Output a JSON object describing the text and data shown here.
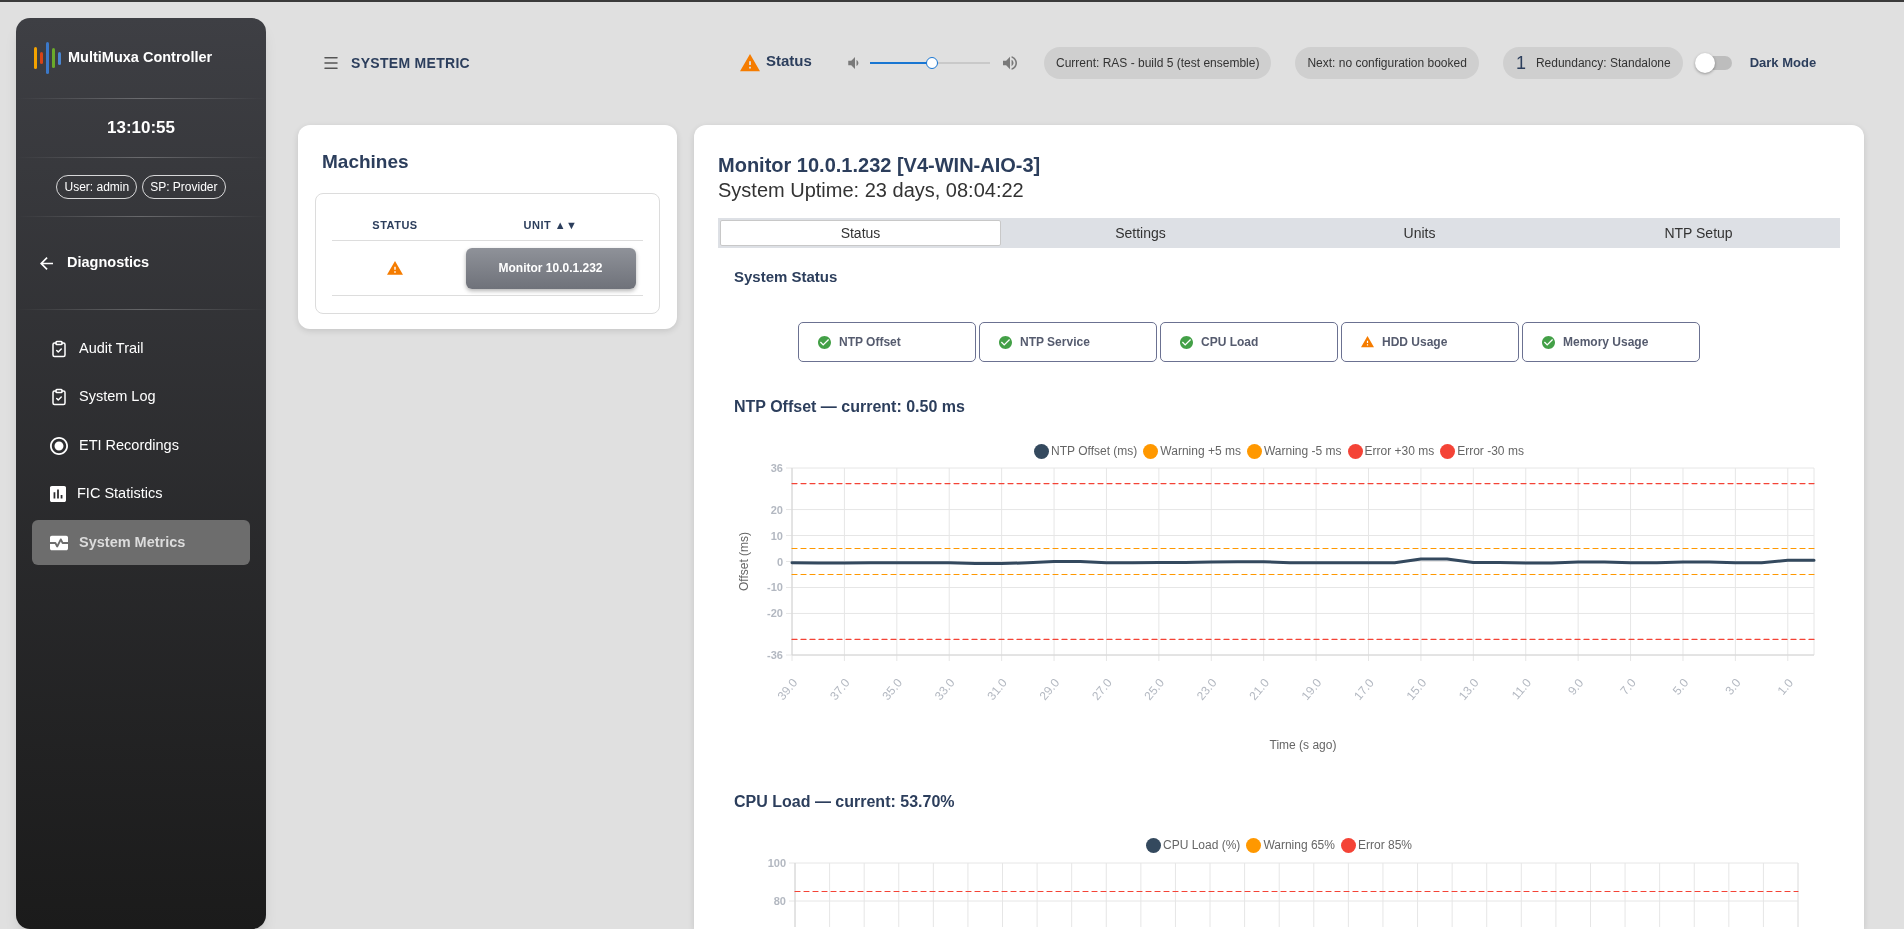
{
  "sidebar": {
    "brand": "MultiMuxa Controller",
    "clock": "13:10:55",
    "badges": [
      "User: admin",
      "SP: Provider"
    ],
    "section": "Diagnostics",
    "items": [
      {
        "label": "Audit Trail",
        "selected": false
      },
      {
        "label": "System Log",
        "selected": false
      },
      {
        "label": "ETI Recordings",
        "selected": false
      },
      {
        "label": "FIC Statistics",
        "selected": false
      },
      {
        "label": "System Metrics",
        "selected": true
      }
    ]
  },
  "header": {
    "title": "SYSTEM METRIC",
    "status": {
      "label": "Status",
      "warning": true
    },
    "volume": {
      "level": 0.52
    },
    "pills": [
      "Current: RAS - build 5 (test ensemble)",
      "Next: no configuration booked"
    ],
    "redundancy": {
      "count": "1",
      "label": "Redundancy: Standalone"
    },
    "dark_mode": {
      "label": "Dark Mode",
      "on": false
    }
  },
  "machines": {
    "title": "Machines",
    "columns": [
      "STATUS",
      "UNIT ▲▼"
    ],
    "rows": [
      {
        "warning": true,
        "unit": "Monitor 10.0.1.232"
      }
    ]
  },
  "monitor": {
    "title": "Monitor 10.0.1.232 [V4-WIN-AIO-3]",
    "uptime": "System Uptime: 23 days, 08:04:22",
    "tabs": [
      {
        "label": "Status",
        "selected": true
      },
      {
        "label": "Settings",
        "selected": false
      },
      {
        "label": "Units",
        "selected": false
      },
      {
        "label": "NTP Setup",
        "selected": false
      }
    ],
    "system_status": {
      "title": "System Status",
      "checks": [
        {
          "label": "NTP Offset",
          "warning": false
        },
        {
          "label": "NTP Service",
          "warning": false
        },
        {
          "label": "CPU Load",
          "warning": false
        },
        {
          "label": "HDD Usage",
          "warning": true
        },
        {
          "label": "Memory Usage",
          "warning": false
        }
      ]
    },
    "charts": [
      {
        "chart_data": {
          "type": "line",
          "title": "NTP Offset — current: 0.50 ms",
          "xlabel": "Time (s ago)",
          "ylabel": "Offset (ms)",
          "grid": true,
          "legend": true,
          "x": [
            39,
            38,
            37,
            36,
            35,
            34,
            33,
            32,
            31,
            30,
            29,
            28,
            27,
            26,
            25,
            24,
            23,
            22,
            21,
            20,
            19,
            18,
            17,
            16,
            15,
            14,
            13,
            12,
            11,
            10,
            9,
            8,
            7,
            6,
            5,
            4,
            3,
            2,
            1,
            0
          ],
          "xlim": [
            39,
            0
          ],
          "xticks": [
            {
              "value": 39,
              "label": "39.0"
            },
            {
              "value": 37,
              "label": "37.0"
            },
            {
              "value": 35,
              "label": "35.0"
            },
            {
              "value": 33,
              "label": "33.0"
            },
            {
              "value": 31,
              "label": "31.0"
            },
            {
              "value": 29,
              "label": "29.0"
            },
            {
              "value": 27,
              "label": "27.0"
            },
            {
              "value": 25,
              "label": "25.0"
            },
            {
              "value": 23,
              "label": "23.0"
            },
            {
              "value": 21,
              "label": "21.0"
            },
            {
              "value": 19,
              "label": "19.0"
            },
            {
              "value": 17,
              "label": "17.0"
            },
            {
              "value": 15,
              "label": "15.0"
            },
            {
              "value": 13,
              "label": "13.0"
            },
            {
              "value": 11,
              "label": "11.0"
            },
            {
              "value": 9,
              "label": "9.0"
            },
            {
              "value": 7,
              "label": "7.0"
            },
            {
              "value": 5,
              "label": "5.0"
            },
            {
              "value": 3,
              "label": "3.0"
            },
            {
              "value": 1,
              "label": "1.0"
            }
          ],
          "ylim": [
            -36,
            36
          ],
          "yticks": [
            36,
            20,
            10,
            0,
            -10,
            -20,
            -36
          ],
          "series": [
            {
              "name": "NTP Offset (ms)",
              "line_style": "solid",
              "color": "#34495e",
              "values": [
                -0.5,
                -0.6,
                -0.6,
                -0.5,
                -0.5,
                -0.5,
                -0.5,
                -0.8,
                -0.8,
                -0.5,
                0.0,
                0.0,
                -0.5,
                -0.5,
                -0.4,
                -0.4,
                -0.2,
                -0.1,
                -0.1,
                -0.5,
                -0.5,
                -0.5,
                -0.5,
                -0.5,
                1.0,
                1.0,
                -0.4,
                -0.4,
                -0.6,
                -0.6,
                -0.2,
                -0.2,
                -0.5,
                -0.5,
                -0.2,
                -0.2,
                -0.5,
                -0.5,
                0.5,
                0.5
              ]
            },
            {
              "name": "Warning +5 ms",
              "line_style": "dashed",
              "color": "#ff9800",
              "values": [
                5,
                5,
                5,
                5,
                5,
                5,
                5,
                5,
                5,
                5,
                5,
                5,
                5,
                5,
                5,
                5,
                5,
                5,
                5,
                5,
                5,
                5,
                5,
                5,
                5,
                5,
                5,
                5,
                5,
                5,
                5,
                5,
                5,
                5,
                5,
                5,
                5,
                5,
                5,
                5
              ]
            },
            {
              "name": "Warning -5 ms",
              "line_style": "dashed",
              "color": "#ff9800",
              "values": [
                -5,
                -5,
                -5,
                -5,
                -5,
                -5,
                -5,
                -5,
                -5,
                -5,
                -5,
                -5,
                -5,
                -5,
                -5,
                -5,
                -5,
                -5,
                -5,
                -5,
                -5,
                -5,
                -5,
                -5,
                -5,
                -5,
                -5,
                -5,
                -5,
                -5,
                -5,
                -5,
                -5,
                -5,
                -5,
                -5,
                -5,
                -5,
                -5,
                -5
              ]
            },
            {
              "name": "Error +30 ms",
              "line_style": "dashed",
              "color": "#f44336",
              "values": [
                30,
                30,
                30,
                30,
                30,
                30,
                30,
                30,
                30,
                30,
                30,
                30,
                30,
                30,
                30,
                30,
                30,
                30,
                30,
                30,
                30,
                30,
                30,
                30,
                30,
                30,
                30,
                30,
                30,
                30,
                30,
                30,
                30,
                30,
                30,
                30,
                30,
                30,
                30,
                30
              ]
            },
            {
              "name": "Error -30 ms",
              "line_style": "dashed",
              "color": "#f44336",
              "values": [
                -30,
                -30,
                -30,
                -30,
                -30,
                -30,
                -30,
                -30,
                -30,
                -30,
                -30,
                -30,
                -30,
                -30,
                -30,
                -30,
                -30,
                -30,
                -30,
                -30,
                -30,
                -30,
                -30,
                -30,
                -30,
                -30,
                -30,
                -30,
                -30,
                -30,
                -30,
                -30,
                -30,
                -30,
                -30,
                -30,
                -30,
                -30,
                -30,
                -30
              ]
            }
          ]
        }
      },
      {
        "chart_data": {
          "type": "line",
          "title": "CPU Load — current: 53.70%",
          "grid": true,
          "legend": true,
          "ylim": [
            0,
            100
          ],
          "yticks": [
            100,
            80
          ],
          "series": [
            {
              "name": "CPU Load (%)",
              "color": "#34495e"
            },
            {
              "name": "Warning 65%",
              "color": "#ff9800"
            },
            {
              "name": "Error 85%",
              "line_style": "dashed",
              "color": "#f44336",
              "values": [
                85,
                85,
                85,
                85,
                85,
                85,
                85,
                85,
                85,
                85,
                85,
                85,
                85,
                85,
                85,
                85,
                85,
                85,
                85,
                85,
                85,
                85,
                85,
                85,
                85,
                85,
                85,
                85,
                85,
                85
              ]
            }
          ]
        }
      }
    ]
  }
}
